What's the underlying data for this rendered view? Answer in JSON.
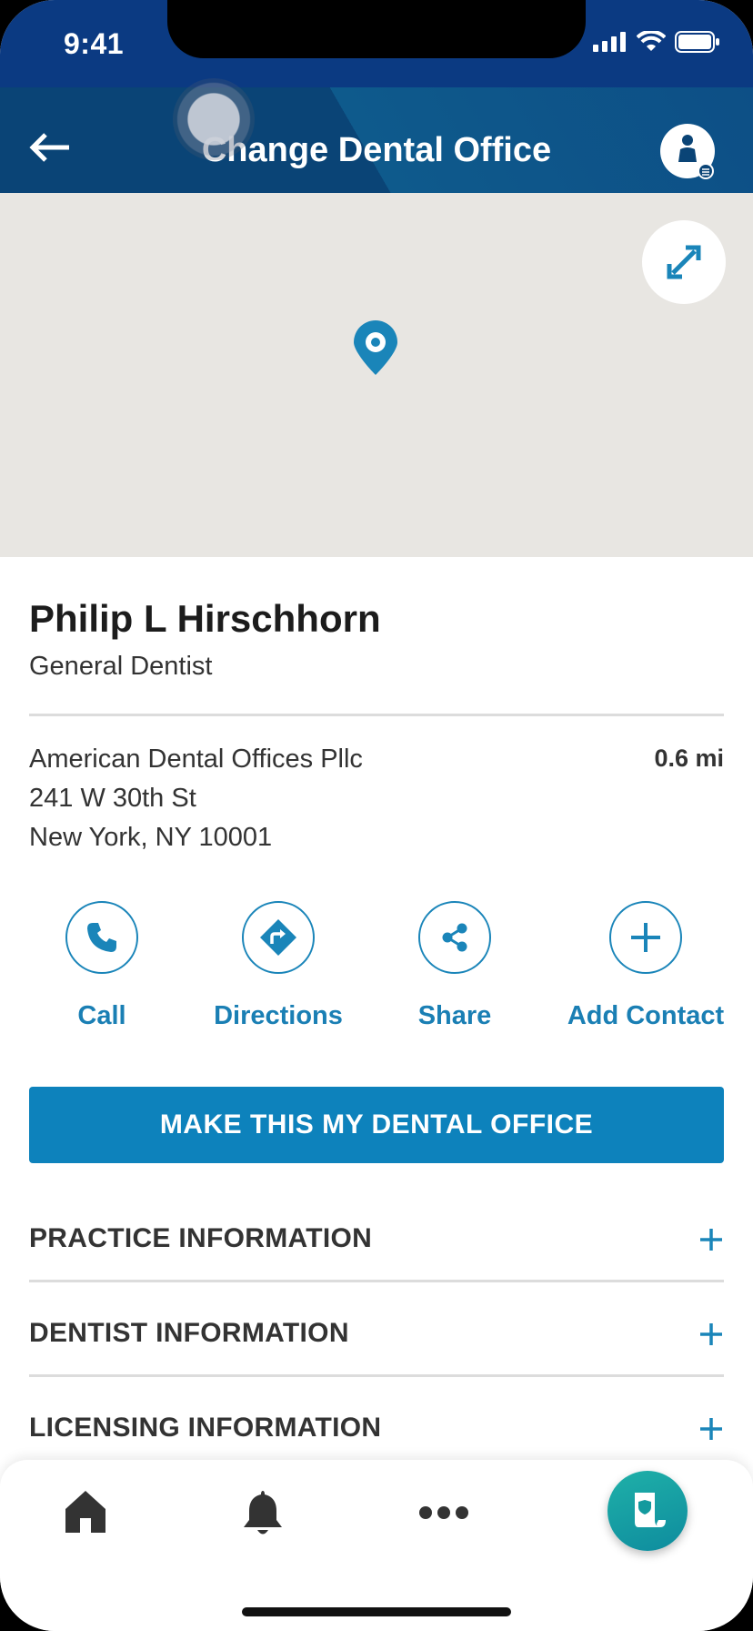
{
  "status_bar": {
    "time": "9:41"
  },
  "header": {
    "title": "Change Dental Office"
  },
  "dentist": {
    "name": "Philip L Hirschhorn",
    "specialty": "General Dentist"
  },
  "office": {
    "name": "American Dental Offices Pllc",
    "street": "241 W 30th St",
    "city_state_zip": "New York, NY 10001",
    "distance": "0.6 mi"
  },
  "actions": {
    "call": "Call",
    "directions": "Directions",
    "share": "Share",
    "add_contact": "Add Contact"
  },
  "primary_button": "MAKE THIS MY DENTAL OFFICE",
  "sections": [
    {
      "title": "PRACTICE INFORMATION"
    },
    {
      "title": "DENTIST INFORMATION"
    },
    {
      "title": "LICENSING INFORMATION"
    }
  ],
  "colors": {
    "header_bg": "#0a4476",
    "status_bg": "#0b3a82",
    "accent": "#1a85b9",
    "primary_button": "#0d82bc",
    "fab": "#1fb0a8"
  },
  "icons": [
    "back-arrow-icon",
    "profile-icon",
    "expand-icon",
    "map-pin-icon",
    "phone-icon",
    "directions-icon",
    "share-icon",
    "plus-icon",
    "home-icon",
    "bell-icon",
    "more-icon",
    "id-card-icon"
  ]
}
